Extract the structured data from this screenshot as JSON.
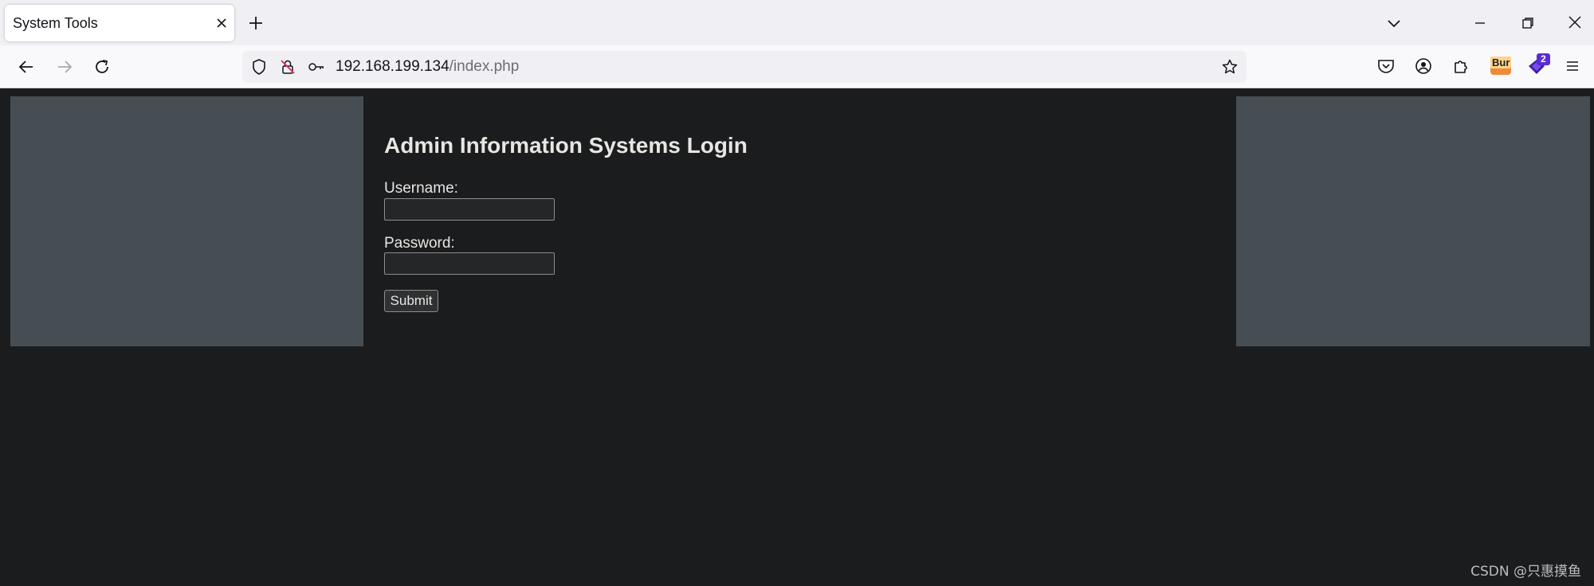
{
  "browser": {
    "tab": {
      "title": "System Tools"
    },
    "url": {
      "host": "192.168.199.134",
      "path": "/index.php"
    },
    "extensions": {
      "burp_label": "Bur",
      "badge_count": "2"
    }
  },
  "page": {
    "title": "Admin Information Systems Login",
    "username_label": "Username:",
    "username_value": "",
    "password_label": "Password:",
    "password_value": "",
    "submit_label": "Submit"
  },
  "watermark": "CSDN @只惠摸鱼",
  "colors": {
    "page_bg": "#1b1c1e",
    "side_panel": "#474e53",
    "text": "#e8e6e3",
    "chrome_bg": "#f0f0f4"
  }
}
